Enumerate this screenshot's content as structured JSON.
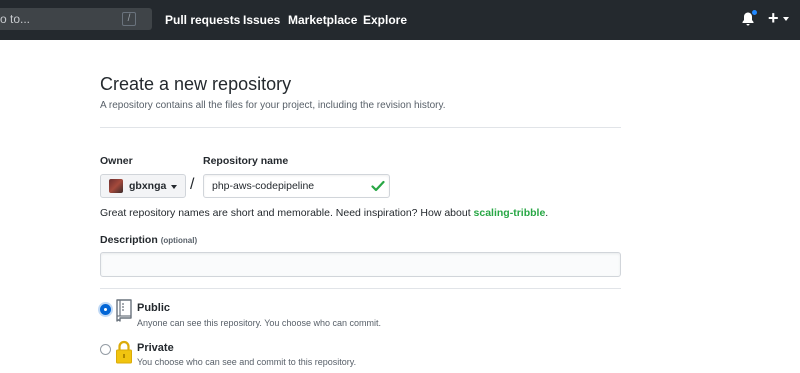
{
  "header": {
    "search_placeholder": "o to...",
    "search_key": "/",
    "nav": [
      "Pull requests",
      "Issues",
      "Marketplace",
      "Explore"
    ],
    "plus": "+"
  },
  "page": {
    "title": "Create a new repository",
    "subtitle": "A repository contains all the files for your project, including the revision history."
  },
  "form": {
    "owner_label": "Owner",
    "owner_value": "gbxnga",
    "separator": "/",
    "repo_label": "Repository name",
    "repo_value": "php-aws-codepipeline",
    "hint_text": "Great repository names are short and memorable. Need inspiration? How about ",
    "hint_suggestion": "scaling-tribble",
    "hint_end": ".",
    "description_label": "Description",
    "description_optional": "(optional)",
    "description_value": ""
  },
  "visibility": {
    "public": {
      "title": "Public",
      "desc": "Anyone can see this repository. You choose who can commit.",
      "selected": true,
      "icon": "repo-book-icon"
    },
    "private": {
      "title": "Private",
      "desc": "You choose who can see and commit to this repository.",
      "selected": false,
      "icon": "lock-icon"
    }
  },
  "colors": {
    "header_bg": "#24292e",
    "accent": "#0366d6",
    "success": "#28a745",
    "notification_dot": "#2188ff"
  }
}
